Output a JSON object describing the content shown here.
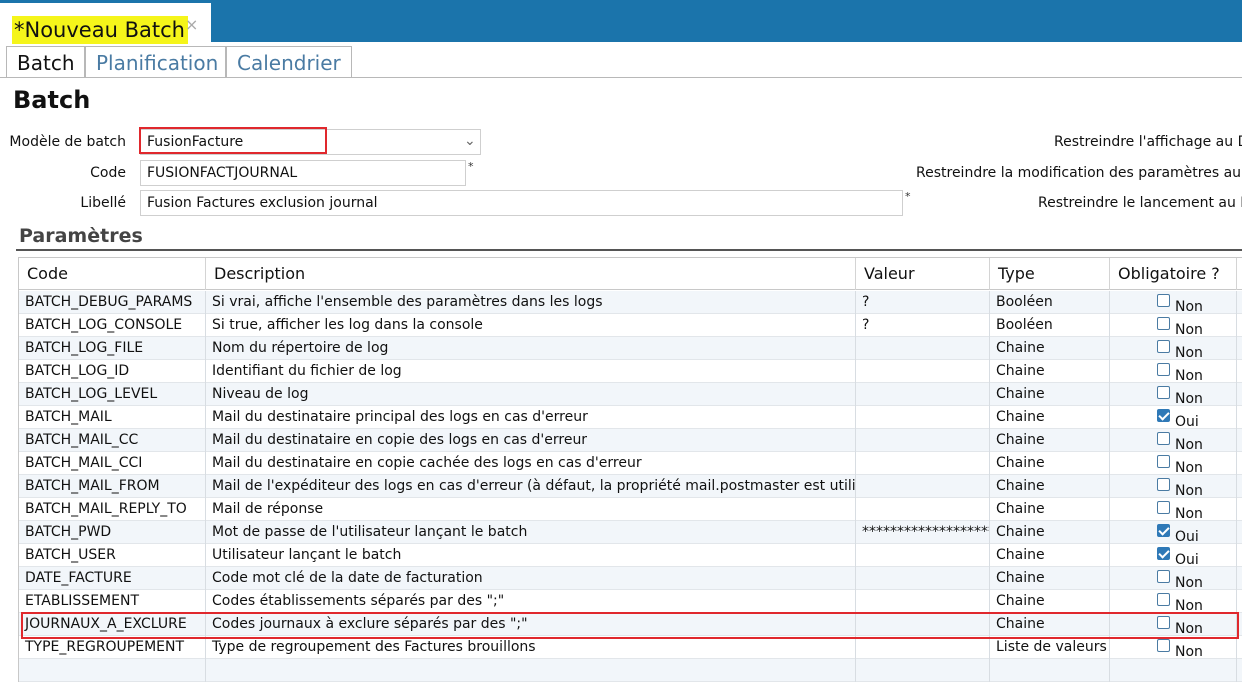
{
  "document_tab": {
    "title": "*Nouveau Batch",
    "close": "×"
  },
  "tabs": [
    "Batch",
    "Planification",
    "Calendrier"
  ],
  "heading": "Batch",
  "form": {
    "model_label": "Modèle de batch",
    "model_value": "FusionFacture",
    "code_label": "Code",
    "code_value": "FUSIONFACTJOURNAL",
    "libelle_label": "Libellé",
    "libelle_value": "Fusion Factures exclusion journal",
    "required_mark": "*",
    "restrict_display": "Restreindre l'affichage au DN",
    "restrict_modify": "Restreindre la modification des paramètres au DN",
    "restrict_launch": "Restreindre le lancement au DN"
  },
  "params_title": "Paramètres",
  "columns": [
    "Code",
    "Description",
    "Valeur",
    "Type",
    "Obligatoire ?"
  ],
  "rows": [
    {
      "code": "BATCH_DEBUG_PARAMS",
      "desc": "Si vrai, affiche l'ensemble des paramètres dans les logs",
      "val": "?",
      "type": "Booléen",
      "oblig": "Non",
      "checked": false
    },
    {
      "code": "BATCH_LOG_CONSOLE",
      "desc": "Si true, afficher les log dans la console",
      "val": "?",
      "type": "Booléen",
      "oblig": "Non",
      "checked": false
    },
    {
      "code": "BATCH_LOG_FILE",
      "desc": "Nom du répertoire de log",
      "val": "",
      "type": "Chaine",
      "oblig": "Non",
      "checked": false
    },
    {
      "code": "BATCH_LOG_ID",
      "desc": "Identifiant du fichier de log",
      "val": "",
      "type": "Chaine",
      "oblig": "Non",
      "checked": false
    },
    {
      "code": "BATCH_LOG_LEVEL",
      "desc": "Niveau de log",
      "val": "",
      "type": "Chaine",
      "oblig": "Non",
      "checked": false
    },
    {
      "code": "BATCH_MAIL",
      "desc": "Mail du destinataire principal des logs en cas d'erreur",
      "val": "",
      "type": "Chaine",
      "oblig": "Oui",
      "checked": true
    },
    {
      "code": "BATCH_MAIL_CC",
      "desc": "Mail du destinataire en copie des logs en cas d'erreur",
      "val": "",
      "type": "Chaine",
      "oblig": "Non",
      "checked": false
    },
    {
      "code": "BATCH_MAIL_CCI",
      "desc": "Mail du destinataire en copie cachée des logs en cas d'erreur",
      "val": "",
      "type": "Chaine",
      "oblig": "Non",
      "checked": false
    },
    {
      "code": "BATCH_MAIL_FROM",
      "desc": "Mail de l'expéditeur des logs en cas d'erreur (à défaut, la propriété mail.postmaster est utilisée)",
      "val": "",
      "type": "Chaine",
      "oblig": "Non",
      "checked": false
    },
    {
      "code": "BATCH_MAIL_REPLY_TO",
      "desc": "Mail de réponse",
      "val": "",
      "type": "Chaine",
      "oblig": "Non",
      "checked": false
    },
    {
      "code": "BATCH_PWD",
      "desc": "Mot de passe de l'utilisateur lançant le batch",
      "val": "********************",
      "type": "Chaine",
      "oblig": "Oui",
      "checked": true
    },
    {
      "code": "BATCH_USER",
      "desc": "Utilisateur lançant le batch",
      "val": "",
      "type": "Chaine",
      "oblig": "Oui",
      "checked": true
    },
    {
      "code": "DATE_FACTURE",
      "desc": "Code mot clé de la date de facturation",
      "val": "",
      "type": "Chaine",
      "oblig": "Non",
      "checked": false
    },
    {
      "code": "ETABLISSEMENT",
      "desc": "Codes établissements séparés par des \";\"",
      "val": "",
      "type": "Chaine",
      "oblig": "Non",
      "checked": false
    },
    {
      "code": "JOURNAUX_A_EXCLURE",
      "desc": "Codes journaux à exclure séparés par des \";\"",
      "val": "",
      "type": "Chaine",
      "oblig": "Non",
      "checked": false
    },
    {
      "code": "TYPE_REGROUPEMENT",
      "desc": "Type de regroupement des Factures brouillons",
      "val": "",
      "type": "Liste de valeurs",
      "oblig": "Non",
      "checked": false
    }
  ]
}
